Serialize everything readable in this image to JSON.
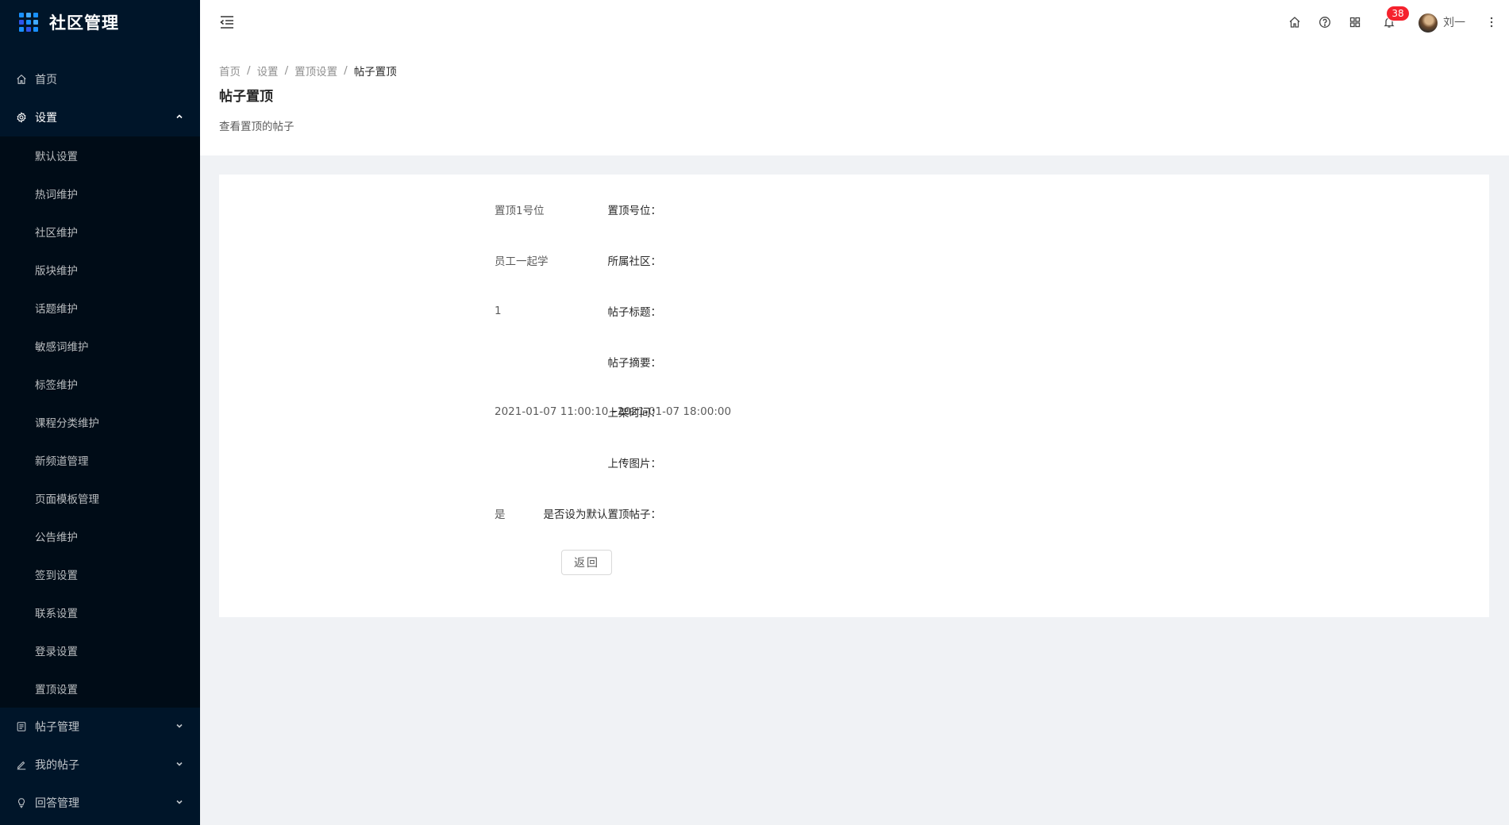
{
  "app": {
    "title": "社区管理"
  },
  "sidebar": {
    "items": [
      {
        "label": "首页",
        "icon": "home-icon"
      },
      {
        "label": "设置",
        "icon": "gear-icon",
        "expanded": true
      },
      {
        "label": "帖子管理",
        "icon": "file-text-icon"
      },
      {
        "label": "我的帖子",
        "icon": "edit-icon"
      },
      {
        "label": "回答管理",
        "icon": "bulb-icon"
      }
    ],
    "settings_children": [
      "默认设置",
      "热词维护",
      "社区维护",
      "版块维护",
      "话题维护",
      "敏感词维护",
      "标签维护",
      "课程分类维护",
      "新频道管理",
      "页面模板管理",
      "公告维护",
      "签到设置",
      "联系设置",
      "登录设置",
      "置顶设置"
    ]
  },
  "header": {
    "notification_count": "38",
    "username": "刘一"
  },
  "breadcrumb": [
    "首页",
    "设置",
    "置顶设置",
    "帖子置顶"
  ],
  "page": {
    "title": "帖子置顶",
    "description": "查看置顶的帖子"
  },
  "detail": {
    "fields": [
      {
        "label": "置顶号位：",
        "value": "置顶1号位"
      },
      {
        "label": "所属社区：",
        "value": "员工一起学"
      },
      {
        "label": "帖子标题：",
        "value": "1"
      },
      {
        "label": "帖子摘要：",
        "value": ""
      },
      {
        "label": "上架时间：",
        "value": "2021-01-07 11:00:10~2021-01-07 18:00:00"
      },
      {
        "label": "上传图片：",
        "value": ""
      },
      {
        "label": "是否设为默认置顶帖子：",
        "value": "是"
      }
    ],
    "back_label": "返回"
  },
  "colors": {
    "sidebar_bg": "#001529",
    "submenu_bg": "#000c17",
    "badge": "#f5222d",
    "primary": "#1890ff"
  }
}
